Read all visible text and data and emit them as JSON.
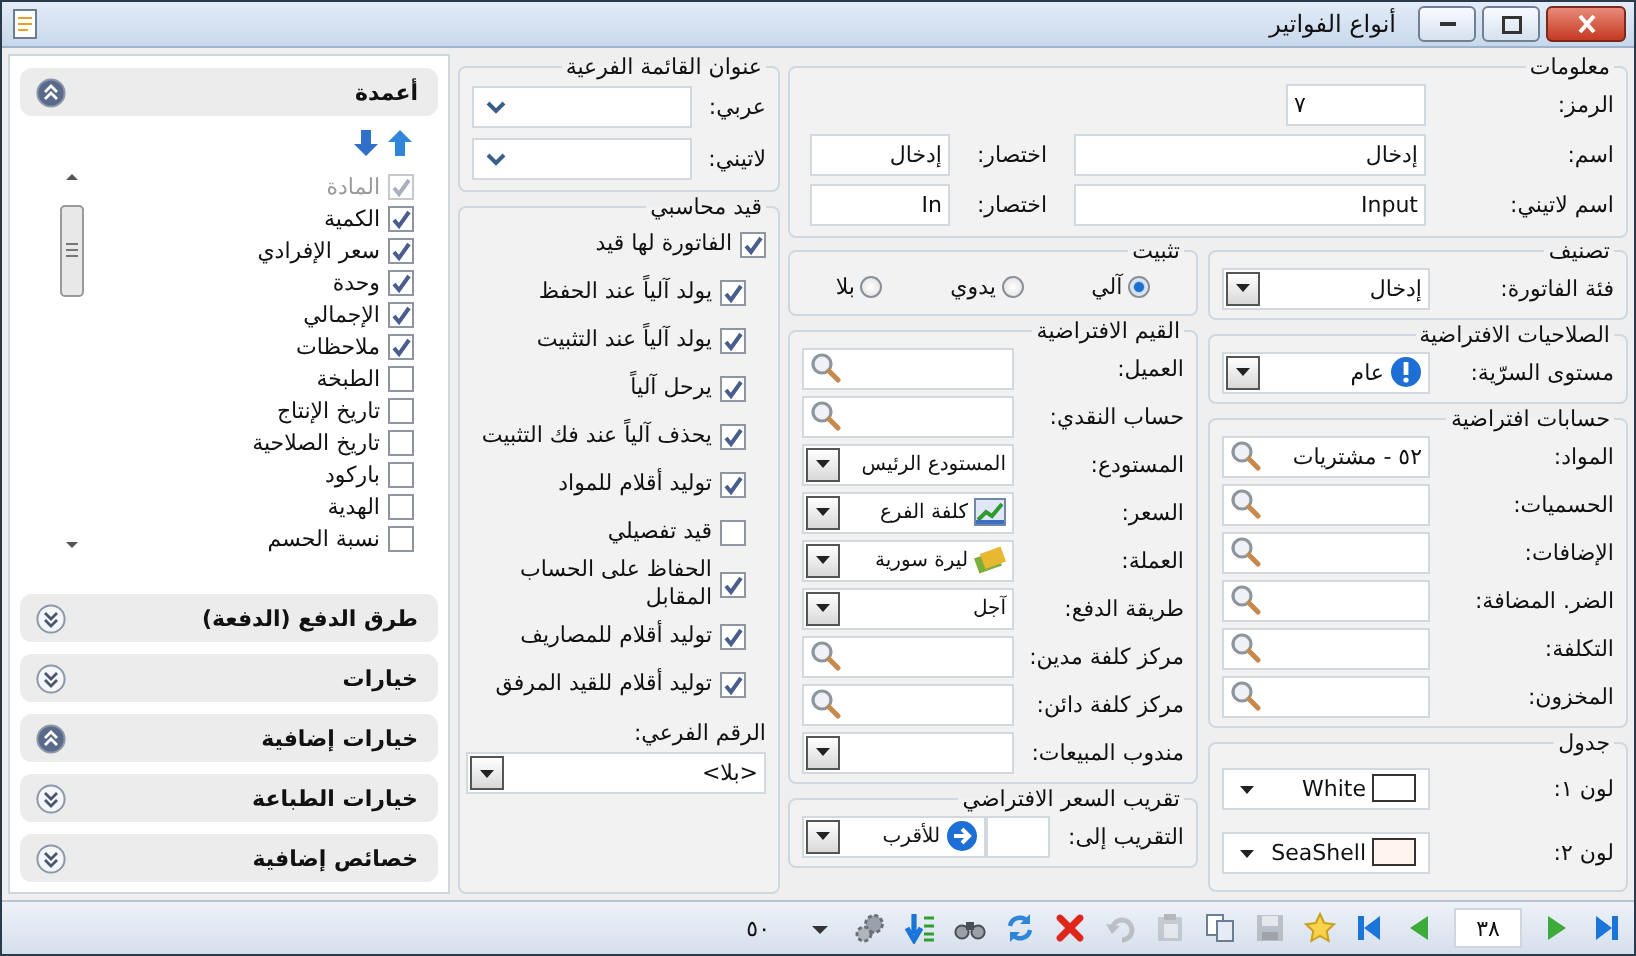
{
  "window": {
    "title": "أنواع الفواتير"
  },
  "info": {
    "title": "معلومات",
    "code": {
      "label": "الرمز:",
      "value": "٧"
    },
    "name": {
      "label": "اسم:",
      "value": "إدخال"
    },
    "name_abbr": {
      "label": "اختصار:",
      "value": "إدخال"
    },
    "latin_name": {
      "label": "اسم لاتيني:",
      "value": "Input"
    },
    "latin_abbr": {
      "label": "اختصار:",
      "value": "In"
    }
  },
  "classification": {
    "title": "تصنيف",
    "fields": [
      {
        "label": "فئة الفاتورة:",
        "kind": "combo",
        "value": "إدخال"
      }
    ]
  },
  "posting": {
    "title": "تثبيت",
    "options": [
      {
        "label": "آلي",
        "selected": true
      },
      {
        "label": "يدوي",
        "selected": false
      },
      {
        "label": "بلا",
        "selected": false
      }
    ]
  },
  "permissions": {
    "title": "الصلاحيات الافتراضية",
    "fields": [
      {
        "label": "مستوى السرّية:",
        "kind": "combo",
        "value": "عام"
      }
    ]
  },
  "defaults": {
    "title": "القيم الافتراضية",
    "fields": [
      {
        "label": "العميل:",
        "kind": "lookup"
      },
      {
        "label": "حساب النقدي:",
        "kind": "lookup"
      },
      {
        "label": "المستودع:",
        "kind": "combo",
        "value": "المستودع الرئيس"
      },
      {
        "label": "السعر:",
        "kind": "combo",
        "value": "كلفة الفرع"
      },
      {
        "label": "العملة:",
        "kind": "combo",
        "value": "ليرة سورية"
      },
      {
        "label": "طريقة الدفع:",
        "kind": "combo",
        "value": "آجل"
      },
      {
        "label": "مركز كلفة مدين:",
        "kind": "lookup"
      },
      {
        "label": "مركز كلفة دائن:",
        "kind": "lookup"
      },
      {
        "label": "مندوب المبيعات:",
        "kind": "combo"
      }
    ]
  },
  "accounts": {
    "title": "حسابات افتراضية",
    "fields": [
      {
        "label": "المواد:",
        "kind": "lookup",
        "value": "٥٢ - مشتريات"
      },
      {
        "label": "الحسميات:",
        "kind": "lookup"
      },
      {
        "label": "الإضافات:",
        "kind": "lookup"
      },
      {
        "label": "الضر. المضافة:",
        "kind": "lookup"
      },
      {
        "label": "التكلفة:",
        "kind": "lookup"
      },
      {
        "label": "المخزون:",
        "kind": "lookup"
      }
    ]
  },
  "grid": {
    "title": "جدول",
    "fields": [
      {
        "label": "لون ١:",
        "kind": "color",
        "value": "White",
        "color": "#ffffff"
      },
      {
        "label": "لون ٢:",
        "kind": "color",
        "value": "SeaShell",
        "color": "#fff5ee"
      }
    ]
  },
  "rounding": {
    "title": "تقريب السعر الافتراضي",
    "fields": [
      {
        "label": "التقريب إلى:",
        "kind": "round",
        "value": "للأقرب"
      }
    ]
  },
  "submenu": {
    "title": "عنوان القائمة الفرعية",
    "fields": [
      {
        "label": "عربي:",
        "kind": "select"
      },
      {
        "label": "لاتيني:",
        "kind": "select"
      }
    ]
  },
  "entry": {
    "title": "قيد محاسبي",
    "checks": [
      {
        "label": "الفاتورة لها قيد",
        "checked": true,
        "children": [
          {
            "label": "يولد آلياً عند الحفظ",
            "checked": true
          },
          {
            "label": "يولد آلياً عند التثبيت",
            "checked": true
          },
          {
            "label": "يرحل آلياً",
            "checked": true
          },
          {
            "label": "يحذف آلياً عند فك التثبيت",
            "checked": true
          },
          {
            "label": "توليد أقلام للمواد",
            "checked": true
          },
          {
            "label": "قيد تفصيلي",
            "checked": false
          },
          {
            "label": "الحفاظ على الحساب المقابل",
            "checked": true
          },
          {
            "label": "توليد أقلام للمصاريف",
            "checked": true
          },
          {
            "label": "توليد أقلام للقيد المرفق",
            "checked": true
          }
        ]
      }
    ],
    "sub_number": {
      "label": "الرقم الفرعي:",
      "value": "<بلا>"
    }
  },
  "sidebar": {
    "sections": [
      {
        "title": "أعمدة",
        "expanded": true,
        "items": [
          {
            "label": "المادة",
            "checked": true,
            "disabled": true
          },
          {
            "label": "الكمية",
            "checked": true,
            "disabled": false
          },
          {
            "label": "سعر الإفرادي",
            "checked": true,
            "disabled": false
          },
          {
            "label": "وحدة",
            "checked": true,
            "disabled": false
          },
          {
            "label": "الإجمالي",
            "checked": true,
            "disabled": false
          },
          {
            "label": "ملاحظات",
            "checked": true,
            "disabled": false
          },
          {
            "label": "الطبخة",
            "checked": false,
            "disabled": false
          },
          {
            "label": "تاريخ الإنتاج",
            "checked": false,
            "disabled": false
          },
          {
            "label": "تاريخ الصلاحية",
            "checked": false,
            "disabled": false
          },
          {
            "label": "باركود",
            "checked": false,
            "disabled": false
          },
          {
            "label": "الهدية",
            "checked": false,
            "disabled": false
          },
          {
            "label": "نسبة الحسم",
            "checked": false,
            "disabled": false
          }
        ]
      },
      {
        "title": "طرق الدفع (الدفعة)",
        "expanded": false
      },
      {
        "title": "خيارات",
        "expanded": false
      },
      {
        "title": "خيارات إضافية",
        "expanded": true
      },
      {
        "title": "خيارات الطباعة",
        "expanded": false
      },
      {
        "title": "خصائص إضافية",
        "expanded": false
      }
    ]
  },
  "toolbar": {
    "buttons": [
      {
        "kind": "last",
        "disabled": false
      },
      {
        "kind": "next",
        "disabled": false
      },
      {
        "kind": "record"
      },
      {
        "kind": "prev",
        "disabled": false
      },
      {
        "kind": "first",
        "disabled": false
      },
      {
        "kind": "star",
        "disabled": false
      },
      {
        "kind": "save",
        "disabled": true
      },
      {
        "kind": "copy",
        "disabled": false
      },
      {
        "kind": "paste",
        "disabled": true
      },
      {
        "kind": "undo",
        "disabled": true
      },
      {
        "kind": "delete",
        "disabled": false
      },
      {
        "kind": "refresh",
        "disabled": false
      },
      {
        "kind": "find",
        "disabled": false
      },
      {
        "kind": "sort",
        "disabled": false
      },
      {
        "kind": "gears",
        "disabled": false
      },
      {
        "kind": "caret",
        "disabled": false
      }
    ],
    "record": "٣٨",
    "page_size": "٥٠"
  }
}
